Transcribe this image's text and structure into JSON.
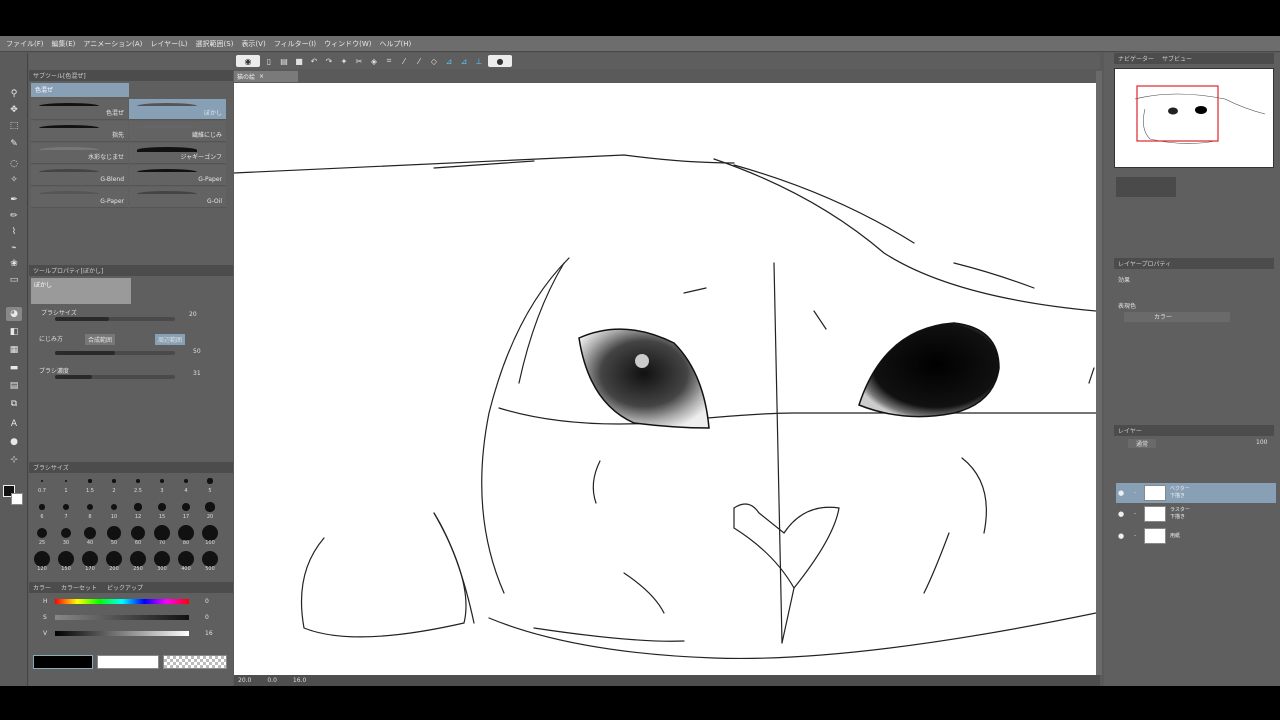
{
  "menu": [
    "ファイル(F)",
    "編集(E)",
    "アニメーション(A)",
    "レイヤー(L)",
    "選択範囲(S)",
    "表示(V)",
    "フィルター(I)",
    "ウィンドウ(W)",
    "ヘルプ(H)"
  ],
  "leftpanel": {
    "subtool_title": "サブツール[色混ぜ]",
    "subtool_group": "色混ぜ",
    "subtools": [
      {
        "label": "色混ぜ"
      },
      {
        "label": "ぼかし"
      },
      {
        "label": "指先"
      },
      {
        "label": "繊維にじみ"
      },
      {
        "label": "水彩なじませ"
      },
      {
        "label": "ジャギーゴンフ"
      },
      {
        "label": "G-Blend"
      },
      {
        "label": "G-Paper"
      },
      {
        "label": "G-Paper"
      },
      {
        "label": "G-Oil"
      }
    ],
    "toolprop_title": "ツールプロパティ[ぼかし]",
    "toolprop_name": "ぼかし",
    "brush_size_label": "ブラシサイズ",
    "brush_size_value": "20",
    "brush_size_level": 0.45,
    "blur_label": "にじみ方",
    "blur_opt1": "合成範囲",
    "blur_opt2": "周辺範囲",
    "blur_value": "50",
    "blur_level": 0.5,
    "brush_density_label": "ブラシ濃度",
    "brush_density_value": "31",
    "brush_density_level": 0.31,
    "brushsize_title": "ブラシサイズ",
    "size_numbers": [
      "0.7",
      "1",
      "1.5",
      "2",
      "2.5",
      "3",
      "4",
      "5",
      "6",
      "7",
      "8",
      "10",
      "12",
      "15",
      "17",
      "20",
      "25",
      "30",
      "40",
      "50",
      "60",
      "70",
      "80",
      "100",
      "120",
      "150",
      "170",
      "200",
      "250",
      "300",
      "400",
      "500"
    ],
    "color_tabs": [
      "カラー",
      "カラーセット",
      "ピックアップ"
    ],
    "color_labels": [
      "H",
      "S",
      "V"
    ],
    "color_values": [
      "0",
      "0",
      "16"
    ]
  },
  "canvas": {
    "tab_title": "猫の絵",
    "status": [
      "20.0",
      "0.0",
      "16.0"
    ]
  },
  "rightpanel": {
    "navigator_title": "ナビゲーター",
    "subview_title": "サブビュー",
    "layerprop_title": "レイヤープロパティ",
    "effect_label": "効果",
    "expression_label": "表現色",
    "expression_value": "カラー",
    "layer_title": "レイヤー",
    "blend_mode": "通常",
    "opacity": "100",
    "layers": [
      {
        "name": "ベクター",
        "sub": "下描き"
      },
      {
        "name": "ラスター",
        "sub": "下描き"
      },
      {
        "name": "用紙",
        "sub": ""
      }
    ]
  },
  "icons": {
    "tool_icons": [
      "magnifier-icon",
      "move-icon",
      "select-icon",
      "eyedropper-icon",
      "pen-icon",
      "pencil-icon",
      "brush-icon",
      "airbrush-icon",
      "blend-icon",
      "eraser-icon",
      "fill-icon",
      "gradient-icon",
      "figure-icon",
      "text-icon",
      "balloon-icon"
    ]
  }
}
